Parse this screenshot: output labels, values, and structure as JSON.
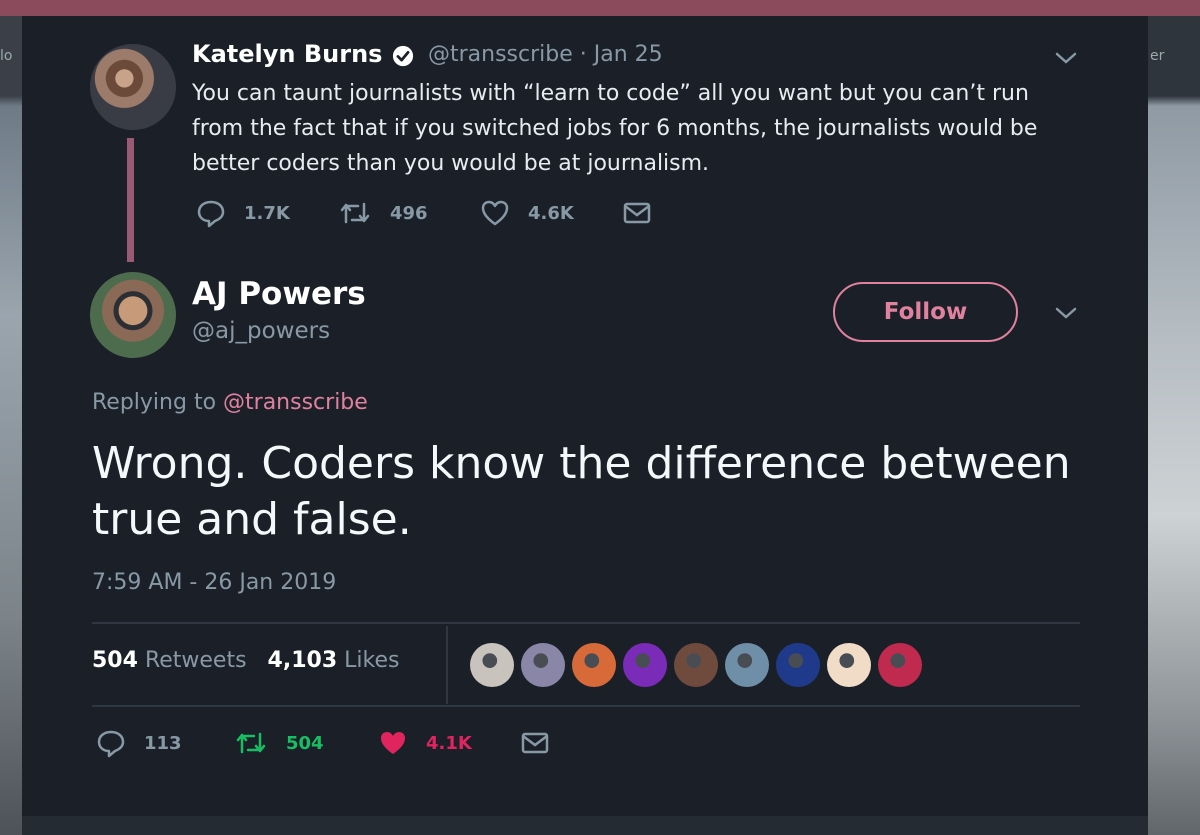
{
  "background": {
    "left_fragment": "lo",
    "right_fragment": "er"
  },
  "parent_tweet": {
    "author_name": "Katelyn Burns",
    "handle_date": "@transscribe · Jan 25",
    "text": "You can taunt journalists with “learn to code” all you want but you can’t run from the fact that if you switched jobs for 6 months, the journalists would be better coders than you would be at journalism.",
    "replies": "1.7K",
    "retweets": "496",
    "likes": "4.6K",
    "verified_icon": "verified-badge-icon"
  },
  "main_tweet": {
    "author_name": "AJ Powers",
    "handle": "@aj_powers",
    "follow_label": "Follow",
    "replying_prefix": "Replying to ",
    "replying_mention": "@transscribe",
    "text": "Wrong. Coders know the difference between true and false.",
    "timestamp": "7:59 AM - 26 Jan 2019",
    "retweet_count": "504",
    "retweet_label": "Retweets",
    "like_count": "4,103",
    "like_label": "Likes",
    "actions": {
      "replies": "113",
      "retweets": "504",
      "likes": "4.1K"
    }
  },
  "colors": {
    "accent": "#e0819e",
    "retweet_green": "#17bf63",
    "like_red": "#e0245e",
    "muted": "#8899a6",
    "card_bg": "#1b2028"
  },
  "likers": [
    {
      "color": "#c9c3bd"
    },
    {
      "color": "#8a86a8"
    },
    {
      "color": "#d86a3a"
    },
    {
      "color": "#7a2bb8"
    },
    {
      "color": "#6e4b3c"
    },
    {
      "color": "#6f8fa8"
    },
    {
      "color": "#1f3a8a"
    },
    {
      "color": "#f1dcc8"
    },
    {
      "color": "#c02a4e"
    }
  ]
}
